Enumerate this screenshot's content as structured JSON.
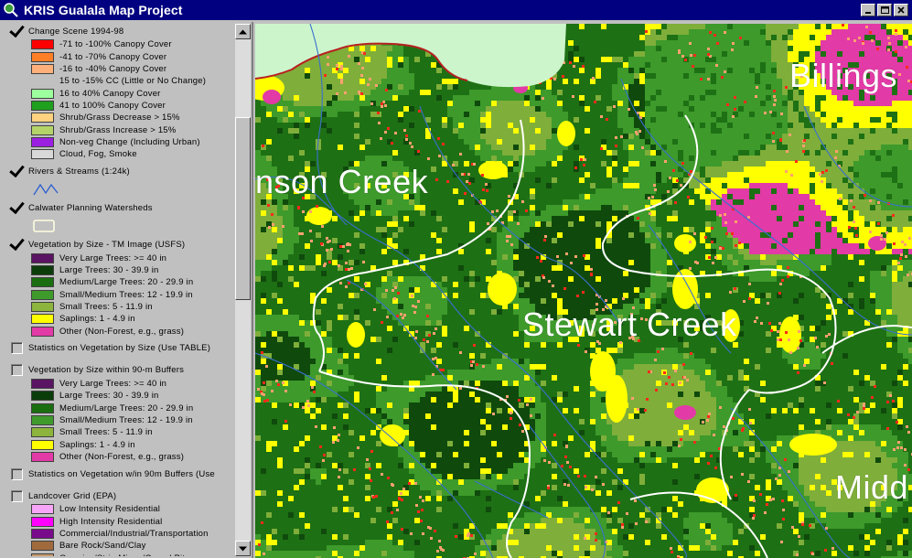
{
  "window": {
    "title": "KRIS Gualala Map Project",
    "app_icon": "magnifier-globe-icon",
    "controls": [
      {
        "name": "minimize-button",
        "glyph": "_"
      },
      {
        "name": "maximize-button",
        "glyph": "□"
      },
      {
        "name": "close-button",
        "glyph": "✕"
      }
    ]
  },
  "legend": {
    "layers": [
      {
        "name": "Change Scene 1994-98",
        "checked": true,
        "classes": [
          {
            "label": "-71 to -100% Canopy Cover",
            "color": "#ff0000"
          },
          {
            "label": "-41 to -70% Canopy Cover",
            "color": "#ff7f27"
          },
          {
            "label": "-16 to -40% Canopy Cover",
            "color": "#ffb07a"
          },
          {
            "label": "15 to -15% CC (Little or No Change)",
            "color": null
          },
          {
            "label": "16 to 40% Canopy Cover",
            "color": "#9dff9d"
          },
          {
            "label": "41 to 100% Canopy Cover",
            "color": "#1fa01f"
          },
          {
            "label": "Shrub/Grass Decrease > 15%",
            "color": "#ffd27f"
          },
          {
            "label": "Shrub/Grass Increase > 15%",
            "color": "#b4d46a"
          },
          {
            "label": "Non-veg Change (Including Urban)",
            "color": "#9b1fe0"
          },
          {
            "label": "Cloud, Fog, Smoke",
            "color": "#d8d8d8"
          }
        ]
      },
      {
        "name": "Rivers & Streams (1:24k)",
        "checked": true,
        "symbol": "river-line-icon"
      },
      {
        "name": "Calwater Planning Watersheds",
        "checked": true,
        "symbol": "watershed-outline-icon"
      },
      {
        "name": "Vegetation by Size - TM Image (USFS)",
        "checked": true,
        "classes": [
          {
            "label": "Very Large Trees: >= 40  in",
            "color": "#5a1463"
          },
          {
            "label": "Large Trees: 30 - 39.9 in",
            "color": "#0b3d0b"
          },
          {
            "label": "Medium/Large Trees: 20 - 29.9 in",
            "color": "#1a6e10"
          },
          {
            "label": "Small/Medium Trees: 12 - 19.9 in",
            "color": "#3f9a2c"
          },
          {
            "label": "Small Trees: 5 - 11.9 in",
            "color": "#8db43c"
          },
          {
            "label": "Saplings: 1 - 4.9 in",
            "color": "#ffff00"
          },
          {
            "label": "Other (Non-Forest, e.g., grass)",
            "color": "#e23aa6"
          }
        ]
      },
      {
        "name": "Statistics on Vegetation by Size (Use TABLE)",
        "checked": false
      },
      {
        "name": "Vegetation by Size within 90-m Buffers",
        "checked": false,
        "classes": [
          {
            "label": "Very Large Trees: >= 40  in",
            "color": "#5a1463"
          },
          {
            "label": "Large Trees: 30 - 39.9 in",
            "color": "#0b3d0b"
          },
          {
            "label": "Medium/Large Trees: 20 - 29.9 in",
            "color": "#1a6e10"
          },
          {
            "label": "Small/Medium Trees: 12 - 19.9 in",
            "color": "#3f9a2c"
          },
          {
            "label": "Small Trees: 5 - 11.9 in",
            "color": "#8db43c"
          },
          {
            "label": "Saplings: 1 - 4.9 in",
            "color": "#ffff00"
          },
          {
            "label": "Other (Non-Forest, e.g., grass)",
            "color": "#e23aa6"
          }
        ]
      },
      {
        "name": "Statistics on Vegetation w/in 90m Buffers (Use",
        "checked": false
      },
      {
        "name": "Landcover Grid (EPA)",
        "checked": false,
        "classes": [
          {
            "label": "Low Intensity Residential",
            "color": "#f7a6f7"
          },
          {
            "label": "High Intensity Residential",
            "color": "#ff00ff"
          },
          {
            "label": "Commercial/Industrial/Transportation",
            "color": "#7a0a8c"
          },
          {
            "label": "Bare Rock/Sand/Clay",
            "color": "#a06a3c"
          },
          {
            "label": "Quarries/Strip Mines/Gravel Pits",
            "color": "#c89a6a"
          }
        ]
      }
    ]
  },
  "map": {
    "watershed_labels": [
      "nson Creek",
      "Stewart Creek",
      "Billings",
      "Midd"
    ],
    "colors": {
      "large": "#0f4a0c",
      "medium_large": "#1e7014",
      "small_medium": "#3d9a2b",
      "small": "#7fae3a",
      "sapling": "#ffff00",
      "other": "#e23aa6",
      "ocean": "#ccf5cc",
      "river": "#3a6fcf",
      "boundary": "#ffffff",
      "change_loss": "#ff2a1a",
      "change_mod": "#ffa070"
    }
  },
  "scrollbar": {
    "up_icon": "scroll-up-arrow-icon",
    "down_icon": "scroll-down-arrow-icon"
  }
}
